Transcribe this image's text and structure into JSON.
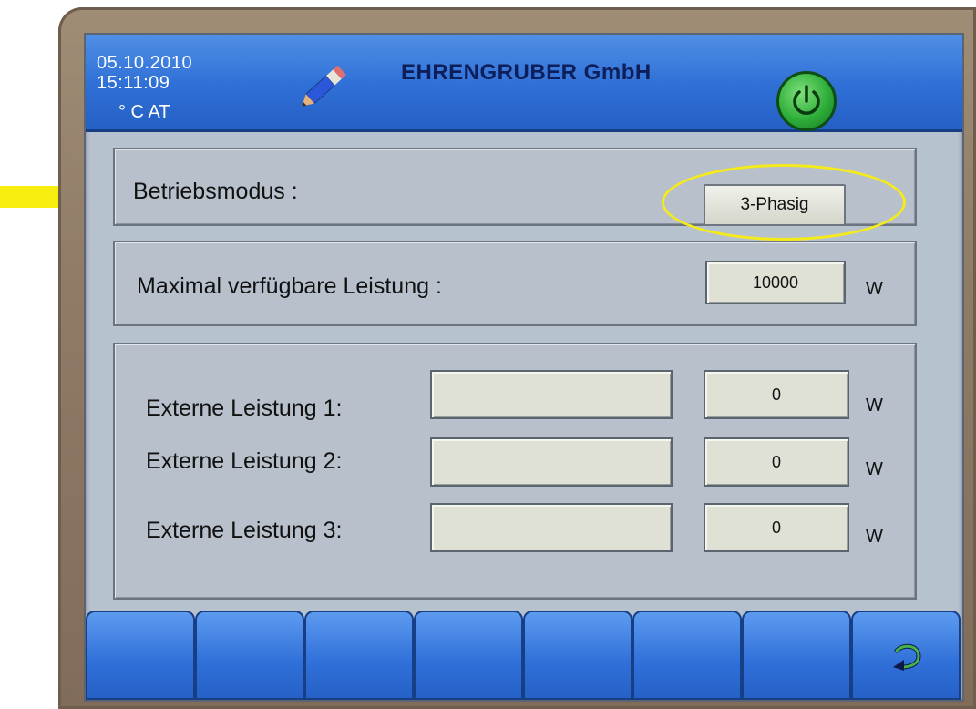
{
  "header": {
    "date": "05.10.2010",
    "time": "15:11:09",
    "units": "° C  AT",
    "title": "EHRENGRUBER GmbH",
    "edit_icon": "pencil-icon",
    "power_icon": "power-icon"
  },
  "mode": {
    "label": "Betriebsmodus :",
    "value": "3-Phasig"
  },
  "max_power": {
    "label": "Maximal verfügbare Leistung :",
    "value": "10000",
    "unit": "W"
  },
  "external": [
    {
      "label": "Externe Leistung 1:",
      "name": "",
      "value": "0",
      "unit": "W"
    },
    {
      "label": "Externe Leistung 2:",
      "name": "",
      "value": "0",
      "unit": "W"
    },
    {
      "label": "Externe Leistung 3:",
      "name": "",
      "value": "0",
      "unit": "W"
    }
  ],
  "footer": {
    "keys": [
      "",
      "",
      "",
      "",
      "",
      "",
      "",
      ""
    ],
    "back_icon": "return-arrow-icon"
  },
  "colors": {
    "header_blue": "#2f6fd6",
    "highlight_yellow": "#f5ea1a",
    "power_green": "#2fae3a"
  }
}
